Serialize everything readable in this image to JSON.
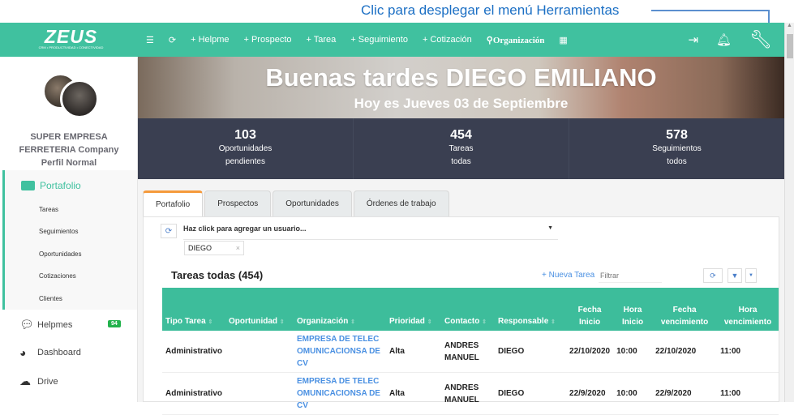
{
  "annotation": "Clic para desplegar el menú Herramientas",
  "nav": {
    "logo": "ZEUS",
    "logo_sub": "CRM • PRODUCTIVIDAD • CONECTIVIDAD",
    "items": [
      "+ Helpme",
      "+ Prospecto",
      "+ Tarea",
      "+ Seguimiento",
      "+ Cotización",
      "Organización"
    ]
  },
  "sidebar": {
    "company": "SUPER EMPRESA FERRETERIA Company",
    "profile": "Perfil Normal",
    "portafolio": "Portafolio",
    "sub": [
      "Tareas",
      "Seguimientos",
      "Oportunidades",
      "Cotizaciones",
      "Clientes"
    ],
    "helpmes": "Helpmes",
    "helpmes_badge": "94",
    "dashboard": "Dashboard",
    "drive": "Drive"
  },
  "hero": {
    "title": "Buenas tardes DIEGO EMILIANO",
    "subtitle": "Hoy es Jueves 03 de Septiembre"
  },
  "stats": [
    {
      "num": "103",
      "l1": "Oportunidades",
      "l2": "pendientes"
    },
    {
      "num": "454",
      "l1": "Tareas",
      "l2": "todas"
    },
    {
      "num": "578",
      "l1": "Seguimientos",
      "l2": "todos"
    }
  ],
  "tabs": [
    "Portafolio",
    "Prospectos",
    "Oportunidades",
    "Órdenes de trabajo"
  ],
  "user_select": "Haz click para agregar un usuario...",
  "chip": "DIEGO",
  "table_title": "Tareas todas (454)",
  "new_task": "+ Nueva Tarea",
  "filter_placeholder": "Filtrar",
  "columns": [
    "Tipo Tarea",
    "Oportunidad",
    "Organización",
    "Prioridad",
    "Contacto",
    "Responsable",
    "Fecha Inicio",
    "Hora Inicio",
    "Fecha vencimiento",
    "Hora vencimiento"
  ],
  "rows": [
    [
      "Administrativo",
      "",
      "EMPRESA DE TELECOMUNICACIONSA DE CV",
      "Alta",
      "ANDRES MANUEL",
      "DIEGO",
      "22/10/2020",
      "10:00",
      "22/10/2020",
      "11:00"
    ],
    [
      "Administrativo",
      "",
      "EMPRESA DE TELECOMUNICACIONSA DE CV",
      "Alta",
      "ANDRES MANUEL",
      "DIEGO",
      "22/9/2020",
      "10:00",
      "22/9/2020",
      "11:00"
    ]
  ]
}
